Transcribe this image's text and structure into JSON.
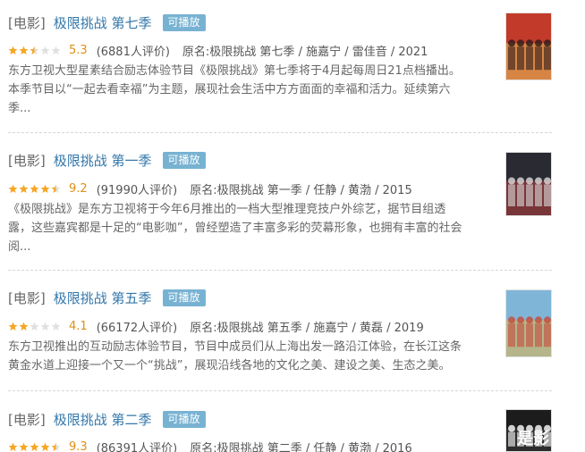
{
  "results": [
    {
      "category": "[电影]",
      "title": "极限挑战 第七季",
      "badge": "可播放",
      "rating_stars": 2.5,
      "score": "5.3",
      "count": "(6881人评价)",
      "meta": "原名:极限挑战 第七季 / 施嘉宁 / 雷佳音 / 2021",
      "desc_lines": [
        "东方卫视大型星素结合励志体验节目《极限挑战》第七季将于4月起每周日21点档播出。",
        "本季节目以“一起去看幸福”为主题，展现社会生活中方方面面的幸福和活力。延续第六",
        "季..."
      ],
      "poster_colors": [
        "#c23a2a",
        "#e8c35a",
        "#2b1a1a"
      ]
    },
    {
      "category": "[电影]",
      "title": "极限挑战 第一季",
      "badge": "可播放",
      "rating_stars": 4.5,
      "score": "9.2",
      "count": "(91990人评价)",
      "meta": "原名:极限挑战 第一季 / 任静 / 黄渤 / 2015",
      "desc_lines": [
        "《极限挑战》是东方卫视将于今年6月推出的一档大型推理竞技户外综艺，据节目组透",
        "露，这些嘉宾都是十足的“电影咖”，曾经塑造了丰富多彩的荧幕形象，也拥有丰富的社会",
        "阅..."
      ],
      "poster_colors": [
        "#2a2a32",
        "#b84040",
        "#dcdcdc"
      ]
    },
    {
      "category": "[电影]",
      "title": "极限挑战 第五季",
      "badge": "可播放",
      "rating_stars": 2,
      "score": "4.1",
      "count": "(66172人评价)",
      "meta": "原名:极限挑战 第五季 / 施嘉宁 / 黄磊 / 2019",
      "desc_lines": [
        "东方卫视推出的互动励志体验节目，节目中成员们从上海出发一路沿江体验，在长江这条",
        "黄金水道上迎接一个又一个“挑战”，展现沿线各地的文化之美、建设之美、生态之美。"
      ],
      "poster_colors": [
        "#7fb6d8",
        "#e2b24a",
        "#c84a3a"
      ]
    },
    {
      "category": "[电影]",
      "title": "极限挑战 第二季",
      "badge": "可播放",
      "rating_stars": 4.5,
      "score": "9.3",
      "count": "(86391人评价)",
      "meta": "原名:极限挑战 第二季 / 任静 / 黄渤 / 2016",
      "poster_text": "是影",
      "desc_lines": [],
      "poster_colors": [
        "#1c1c1c",
        "#3a3a3a",
        "#ffffff"
      ]
    }
  ]
}
